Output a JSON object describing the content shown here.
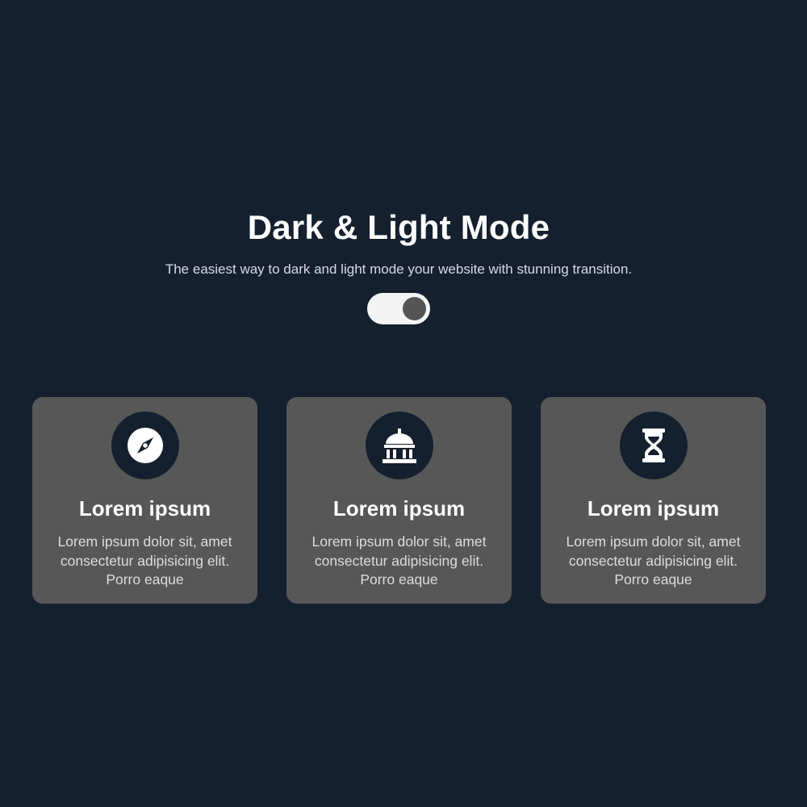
{
  "hero": {
    "title": "Dark & Light Mode",
    "subtitle": "The easiest way to dark and light mode your website with stunning transition."
  },
  "theme_toggle": {
    "state": "dark"
  },
  "cards": [
    {
      "icon": "compass-icon",
      "title": "Lorem ipsum",
      "text": "Lorem ipsum dolor sit, amet consectetur adipisicing elit. Porro eaque"
    },
    {
      "icon": "landmark-icon",
      "title": "Lorem ipsum",
      "text": "Lorem ipsum dolor sit, amet consectetur adipisicing elit. Porro eaque"
    },
    {
      "icon": "hourglass-icon",
      "title": "Lorem ipsum",
      "text": "Lorem ipsum dolor sit, amet consectetur adipisicing elit. Porro eaque"
    }
  ],
  "colors": {
    "background": "#15202e",
    "card": "#575757",
    "toggle_track": "#f4f4f4",
    "toggle_knob": "#555555",
    "text": "#ffffff"
  }
}
